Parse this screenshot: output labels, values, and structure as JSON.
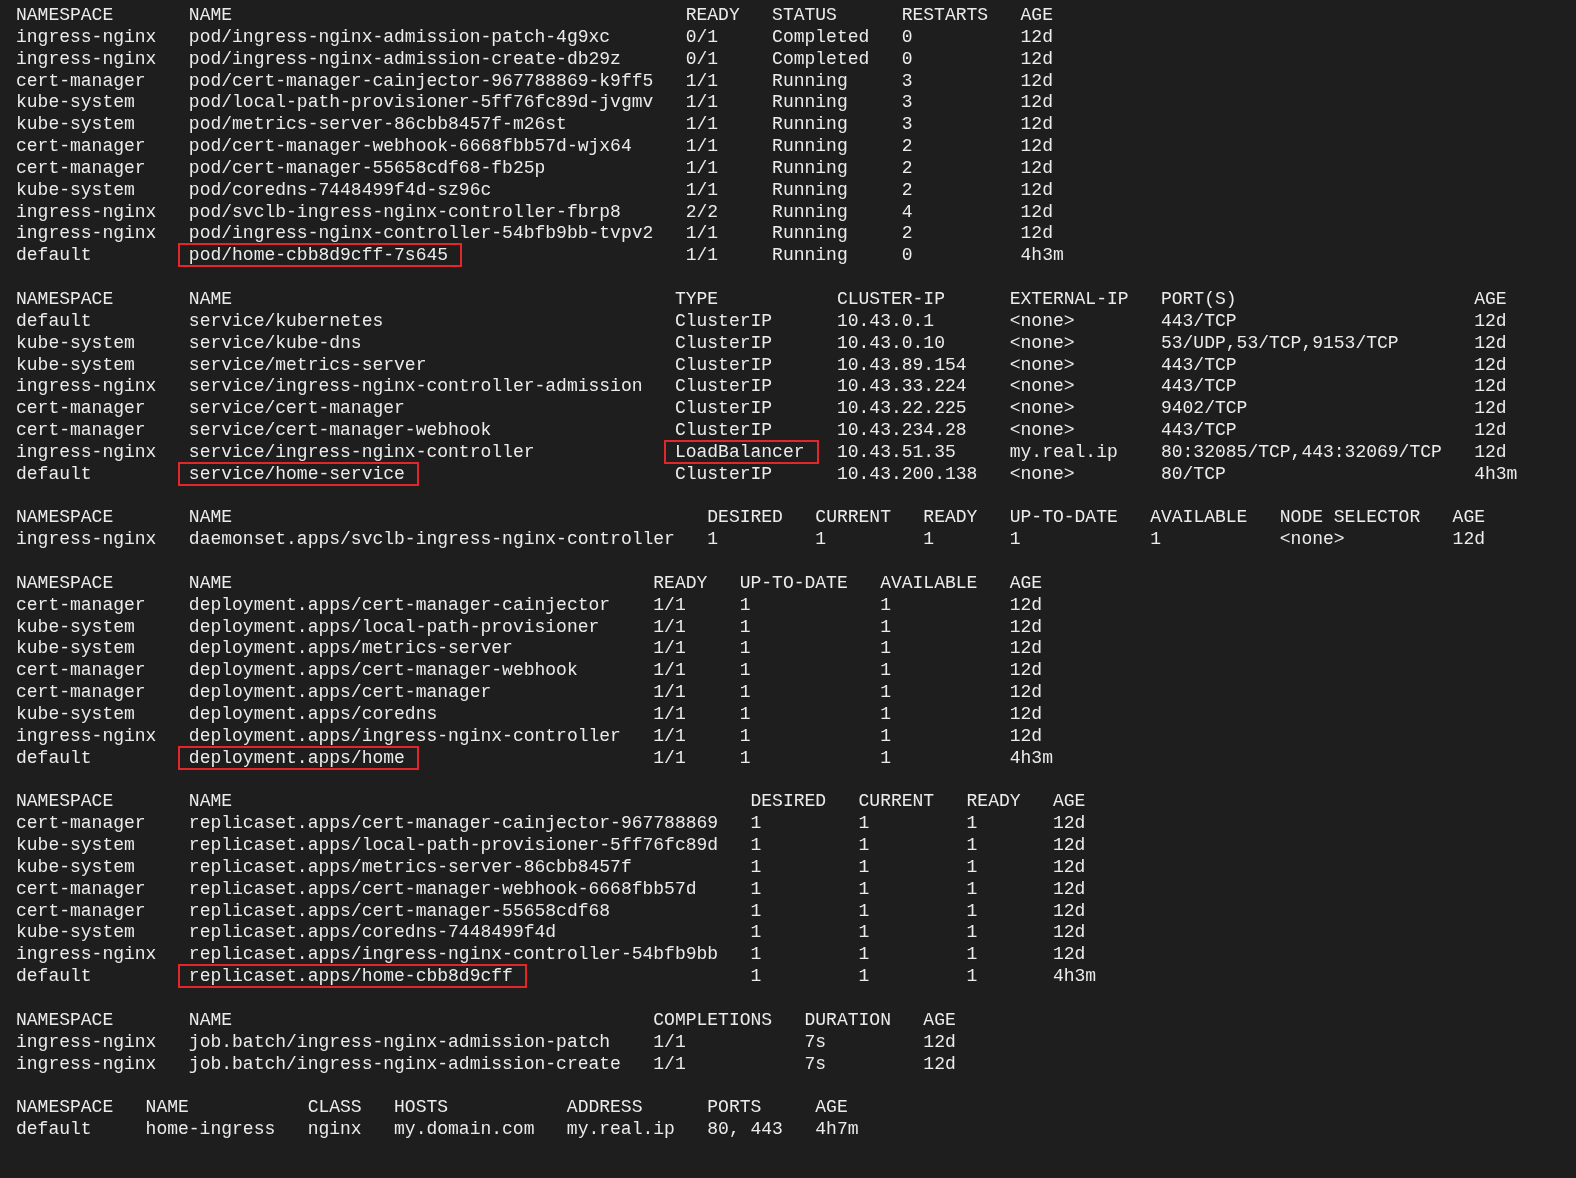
{
  "tables": [
    {
      "columns": [
        "NAMESPACE",
        "NAME",
        "READY",
        "STATUS",
        "RESTARTS",
        "AGE"
      ],
      "rows": [
        {
          "cells": [
            {
              "text": "ingress-nginx",
              "boxed": false
            },
            {
              "text": "pod/ingress-nginx-admission-patch-4g9xc",
              "boxed": false
            },
            {
              "text": "0/1",
              "boxed": false
            },
            {
              "text": "Completed",
              "boxed": false
            },
            {
              "text": "0",
              "boxed": false
            },
            {
              "text": "12d",
              "boxed": false
            }
          ]
        },
        {
          "cells": [
            {
              "text": "ingress-nginx",
              "boxed": false
            },
            {
              "text": "pod/ingress-nginx-admission-create-db29z",
              "boxed": false
            },
            {
              "text": "0/1",
              "boxed": false
            },
            {
              "text": "Completed",
              "boxed": false
            },
            {
              "text": "0",
              "boxed": false
            },
            {
              "text": "12d",
              "boxed": false
            }
          ]
        },
        {
          "cells": [
            {
              "text": "cert-manager",
              "boxed": false
            },
            {
              "text": "pod/cert-manager-cainjector-967788869-k9ff5",
              "boxed": false
            },
            {
              "text": "1/1",
              "boxed": false
            },
            {
              "text": "Running",
              "boxed": false
            },
            {
              "text": "3",
              "boxed": false
            },
            {
              "text": "12d",
              "boxed": false
            }
          ]
        },
        {
          "cells": [
            {
              "text": "kube-system",
              "boxed": false
            },
            {
              "text": "pod/local-path-provisioner-5ff76fc89d-jvgmv",
              "boxed": false
            },
            {
              "text": "1/1",
              "boxed": false
            },
            {
              "text": "Running",
              "boxed": false
            },
            {
              "text": "3",
              "boxed": false
            },
            {
              "text": "12d",
              "boxed": false
            }
          ]
        },
        {
          "cells": [
            {
              "text": "kube-system",
              "boxed": false
            },
            {
              "text": "pod/metrics-server-86cbb8457f-m26st",
              "boxed": false
            },
            {
              "text": "1/1",
              "boxed": false
            },
            {
              "text": "Running",
              "boxed": false
            },
            {
              "text": "3",
              "boxed": false
            },
            {
              "text": "12d",
              "boxed": false
            }
          ]
        },
        {
          "cells": [
            {
              "text": "cert-manager",
              "boxed": false
            },
            {
              "text": "pod/cert-manager-webhook-6668fbb57d-wjx64",
              "boxed": false
            },
            {
              "text": "1/1",
              "boxed": false
            },
            {
              "text": "Running",
              "boxed": false
            },
            {
              "text": "2",
              "boxed": false
            },
            {
              "text": "12d",
              "boxed": false
            }
          ]
        },
        {
          "cells": [
            {
              "text": "cert-manager",
              "boxed": false
            },
            {
              "text": "pod/cert-manager-55658cdf68-fb25p",
              "boxed": false
            },
            {
              "text": "1/1",
              "boxed": false
            },
            {
              "text": "Running",
              "boxed": false
            },
            {
              "text": "2",
              "boxed": false
            },
            {
              "text": "12d",
              "boxed": false
            }
          ]
        },
        {
          "cells": [
            {
              "text": "kube-system",
              "boxed": false
            },
            {
              "text": "pod/coredns-7448499f4d-sz96c",
              "boxed": false
            },
            {
              "text": "1/1",
              "boxed": false
            },
            {
              "text": "Running",
              "boxed": false
            },
            {
              "text": "2",
              "boxed": false
            },
            {
              "text": "12d",
              "boxed": false
            }
          ]
        },
        {
          "cells": [
            {
              "text": "ingress-nginx",
              "boxed": false
            },
            {
              "text": "pod/svclb-ingress-nginx-controller-fbrp8",
              "boxed": false
            },
            {
              "text": "2/2",
              "boxed": false
            },
            {
              "text": "Running",
              "boxed": false
            },
            {
              "text": "4",
              "boxed": false
            },
            {
              "text": "12d",
              "boxed": false
            }
          ]
        },
        {
          "cells": [
            {
              "text": "ingress-nginx",
              "boxed": false
            },
            {
              "text": "pod/ingress-nginx-controller-54bfb9bb-tvpv2",
              "boxed": false
            },
            {
              "text": "1/1",
              "boxed": false
            },
            {
              "text": "Running",
              "boxed": false
            },
            {
              "text": "2",
              "boxed": false
            },
            {
              "text": "12d",
              "boxed": false
            }
          ]
        },
        {
          "cells": [
            {
              "text": "default",
              "boxed": false
            },
            {
              "text": "pod/home-cbb8d9cff-7s645",
              "boxed": true
            },
            {
              "text": "1/1",
              "boxed": false
            },
            {
              "text": "Running",
              "boxed": false
            },
            {
              "text": "0",
              "boxed": false
            },
            {
              "text": "4h3m",
              "boxed": false
            }
          ]
        }
      ]
    },
    {
      "columns": [
        "NAMESPACE",
        "NAME",
        "TYPE",
        "CLUSTER-IP",
        "EXTERNAL-IP",
        "PORT(S)",
        "AGE"
      ],
      "rows": [
        {
          "cells": [
            {
              "text": "default",
              "boxed": false
            },
            {
              "text": "service/kubernetes",
              "boxed": false
            },
            {
              "text": "ClusterIP",
              "boxed": false
            },
            {
              "text": "10.43.0.1",
              "boxed": false
            },
            {
              "text": "<none>",
              "boxed": false
            },
            {
              "text": "443/TCP",
              "boxed": false
            },
            {
              "text": "12d",
              "boxed": false
            }
          ]
        },
        {
          "cells": [
            {
              "text": "kube-system",
              "boxed": false
            },
            {
              "text": "service/kube-dns",
              "boxed": false
            },
            {
              "text": "ClusterIP",
              "boxed": false
            },
            {
              "text": "10.43.0.10",
              "boxed": false
            },
            {
              "text": "<none>",
              "boxed": false
            },
            {
              "text": "53/UDP,53/TCP,9153/TCP",
              "boxed": false
            },
            {
              "text": "12d",
              "boxed": false
            }
          ]
        },
        {
          "cells": [
            {
              "text": "kube-system",
              "boxed": false
            },
            {
              "text": "service/metrics-server",
              "boxed": false
            },
            {
              "text": "ClusterIP",
              "boxed": false
            },
            {
              "text": "10.43.89.154",
              "boxed": false
            },
            {
              "text": "<none>",
              "boxed": false
            },
            {
              "text": "443/TCP",
              "boxed": false
            },
            {
              "text": "12d",
              "boxed": false
            }
          ]
        },
        {
          "cells": [
            {
              "text": "ingress-nginx",
              "boxed": false
            },
            {
              "text": "service/ingress-nginx-controller-admission",
              "boxed": false
            },
            {
              "text": "ClusterIP",
              "boxed": false
            },
            {
              "text": "10.43.33.224",
              "boxed": false
            },
            {
              "text": "<none>",
              "boxed": false
            },
            {
              "text": "443/TCP",
              "boxed": false
            },
            {
              "text": "12d",
              "boxed": false
            }
          ]
        },
        {
          "cells": [
            {
              "text": "cert-manager",
              "boxed": false
            },
            {
              "text": "service/cert-manager",
              "boxed": false
            },
            {
              "text": "ClusterIP",
              "boxed": false
            },
            {
              "text": "10.43.22.225",
              "boxed": false
            },
            {
              "text": "<none>",
              "boxed": false
            },
            {
              "text": "9402/TCP",
              "boxed": false
            },
            {
              "text": "12d",
              "boxed": false
            }
          ]
        },
        {
          "cells": [
            {
              "text": "cert-manager",
              "boxed": false
            },
            {
              "text": "service/cert-manager-webhook",
              "boxed": false
            },
            {
              "text": "ClusterIP",
              "boxed": false
            },
            {
              "text": "10.43.234.28",
              "boxed": false
            },
            {
              "text": "<none>",
              "boxed": false
            },
            {
              "text": "443/TCP",
              "boxed": false
            },
            {
              "text": "12d",
              "boxed": false
            }
          ]
        },
        {
          "cells": [
            {
              "text": "ingress-nginx",
              "boxed": false
            },
            {
              "text": "service/ingress-nginx-controller",
              "boxed": false
            },
            {
              "text": "LoadBalancer",
              "boxed": true
            },
            {
              "text": "10.43.51.35",
              "boxed": false
            },
            {
              "text": "my.real.ip",
              "boxed": false
            },
            {
              "text": "80:32085/TCP,443:32069/TCP",
              "boxed": false
            },
            {
              "text": "12d",
              "boxed": false
            }
          ]
        },
        {
          "cells": [
            {
              "text": "default",
              "boxed": false
            },
            {
              "text": "service/home-service",
              "boxed": true
            },
            {
              "text": "ClusterIP",
              "boxed": false
            },
            {
              "text": "10.43.200.138",
              "boxed": false
            },
            {
              "text": "<none>",
              "boxed": false
            },
            {
              "text": "80/TCP",
              "boxed": false
            },
            {
              "text": "4h3m",
              "boxed": false
            }
          ]
        }
      ]
    },
    {
      "columns": [
        "NAMESPACE",
        "NAME",
        "DESIRED",
        "CURRENT",
        "READY",
        "UP-TO-DATE",
        "AVAILABLE",
        "NODE SELECTOR",
        "AGE"
      ],
      "rows": [
        {
          "cells": [
            {
              "text": "ingress-nginx",
              "boxed": false
            },
            {
              "text": "daemonset.apps/svclb-ingress-nginx-controller",
              "boxed": false
            },
            {
              "text": "1",
              "boxed": false
            },
            {
              "text": "1",
              "boxed": false
            },
            {
              "text": "1",
              "boxed": false
            },
            {
              "text": "1",
              "boxed": false
            },
            {
              "text": "1",
              "boxed": false
            },
            {
              "text": "<none>",
              "boxed": false
            },
            {
              "text": "12d",
              "boxed": false
            }
          ]
        }
      ]
    },
    {
      "columns": [
        "NAMESPACE",
        "NAME",
        "READY",
        "UP-TO-DATE",
        "AVAILABLE",
        "AGE"
      ],
      "rows": [
        {
          "cells": [
            {
              "text": "cert-manager",
              "boxed": false
            },
            {
              "text": "deployment.apps/cert-manager-cainjector",
              "boxed": false
            },
            {
              "text": "1/1",
              "boxed": false
            },
            {
              "text": "1",
              "boxed": false
            },
            {
              "text": "1",
              "boxed": false
            },
            {
              "text": "12d",
              "boxed": false
            }
          ]
        },
        {
          "cells": [
            {
              "text": "kube-system",
              "boxed": false
            },
            {
              "text": "deployment.apps/local-path-provisioner",
              "boxed": false
            },
            {
              "text": "1/1",
              "boxed": false
            },
            {
              "text": "1",
              "boxed": false
            },
            {
              "text": "1",
              "boxed": false
            },
            {
              "text": "12d",
              "boxed": false
            }
          ]
        },
        {
          "cells": [
            {
              "text": "kube-system",
              "boxed": false
            },
            {
              "text": "deployment.apps/metrics-server",
              "boxed": false
            },
            {
              "text": "1/1",
              "boxed": false
            },
            {
              "text": "1",
              "boxed": false
            },
            {
              "text": "1",
              "boxed": false
            },
            {
              "text": "12d",
              "boxed": false
            }
          ]
        },
        {
          "cells": [
            {
              "text": "cert-manager",
              "boxed": false
            },
            {
              "text": "deployment.apps/cert-manager-webhook",
              "boxed": false
            },
            {
              "text": "1/1",
              "boxed": false
            },
            {
              "text": "1",
              "boxed": false
            },
            {
              "text": "1",
              "boxed": false
            },
            {
              "text": "12d",
              "boxed": false
            }
          ]
        },
        {
          "cells": [
            {
              "text": "cert-manager",
              "boxed": false
            },
            {
              "text": "deployment.apps/cert-manager",
              "boxed": false
            },
            {
              "text": "1/1",
              "boxed": false
            },
            {
              "text": "1",
              "boxed": false
            },
            {
              "text": "1",
              "boxed": false
            },
            {
              "text": "12d",
              "boxed": false
            }
          ]
        },
        {
          "cells": [
            {
              "text": "kube-system",
              "boxed": false
            },
            {
              "text": "deployment.apps/coredns",
              "boxed": false
            },
            {
              "text": "1/1",
              "boxed": false
            },
            {
              "text": "1",
              "boxed": false
            },
            {
              "text": "1",
              "boxed": false
            },
            {
              "text": "12d",
              "boxed": false
            }
          ]
        },
        {
          "cells": [
            {
              "text": "ingress-nginx",
              "boxed": false
            },
            {
              "text": "deployment.apps/ingress-nginx-controller",
              "boxed": false
            },
            {
              "text": "1/1",
              "boxed": false
            },
            {
              "text": "1",
              "boxed": false
            },
            {
              "text": "1",
              "boxed": false
            },
            {
              "text": "12d",
              "boxed": false
            }
          ]
        },
        {
          "cells": [
            {
              "text": "default",
              "boxed": false
            },
            {
              "text": "deployment.apps/home",
              "boxed": true
            },
            {
              "text": "1/1",
              "boxed": false
            },
            {
              "text": "1",
              "boxed": false
            },
            {
              "text": "1",
              "boxed": false
            },
            {
              "text": "4h3m",
              "boxed": false
            }
          ]
        }
      ]
    },
    {
      "columns": [
        "NAMESPACE",
        "NAME",
        "DESIRED",
        "CURRENT",
        "READY",
        "AGE"
      ],
      "rows": [
        {
          "cells": [
            {
              "text": "cert-manager",
              "boxed": false
            },
            {
              "text": "replicaset.apps/cert-manager-cainjector-967788869",
              "boxed": false
            },
            {
              "text": "1",
              "boxed": false
            },
            {
              "text": "1",
              "boxed": false
            },
            {
              "text": "1",
              "boxed": false
            },
            {
              "text": "12d",
              "boxed": false
            }
          ]
        },
        {
          "cells": [
            {
              "text": "kube-system",
              "boxed": false
            },
            {
              "text": "replicaset.apps/local-path-provisioner-5ff76fc89d",
              "boxed": false
            },
            {
              "text": "1",
              "boxed": false
            },
            {
              "text": "1",
              "boxed": false
            },
            {
              "text": "1",
              "boxed": false
            },
            {
              "text": "12d",
              "boxed": false
            }
          ]
        },
        {
          "cells": [
            {
              "text": "kube-system",
              "boxed": false
            },
            {
              "text": "replicaset.apps/metrics-server-86cbb8457f",
              "boxed": false
            },
            {
              "text": "1",
              "boxed": false
            },
            {
              "text": "1",
              "boxed": false
            },
            {
              "text": "1",
              "boxed": false
            },
            {
              "text": "12d",
              "boxed": false
            }
          ]
        },
        {
          "cells": [
            {
              "text": "cert-manager",
              "boxed": false
            },
            {
              "text": "replicaset.apps/cert-manager-webhook-6668fbb57d",
              "boxed": false
            },
            {
              "text": "1",
              "boxed": false
            },
            {
              "text": "1",
              "boxed": false
            },
            {
              "text": "1",
              "boxed": false
            },
            {
              "text": "12d",
              "boxed": false
            }
          ]
        },
        {
          "cells": [
            {
              "text": "cert-manager",
              "boxed": false
            },
            {
              "text": "replicaset.apps/cert-manager-55658cdf68",
              "boxed": false
            },
            {
              "text": "1",
              "boxed": false
            },
            {
              "text": "1",
              "boxed": false
            },
            {
              "text": "1",
              "boxed": false
            },
            {
              "text": "12d",
              "boxed": false
            }
          ]
        },
        {
          "cells": [
            {
              "text": "kube-system",
              "boxed": false
            },
            {
              "text": "replicaset.apps/coredns-7448499f4d",
              "boxed": false
            },
            {
              "text": "1",
              "boxed": false
            },
            {
              "text": "1",
              "boxed": false
            },
            {
              "text": "1",
              "boxed": false
            },
            {
              "text": "12d",
              "boxed": false
            }
          ]
        },
        {
          "cells": [
            {
              "text": "ingress-nginx",
              "boxed": false
            },
            {
              "text": "replicaset.apps/ingress-nginx-controller-54bfb9bb",
              "boxed": false
            },
            {
              "text": "1",
              "boxed": false
            },
            {
              "text": "1",
              "boxed": false
            },
            {
              "text": "1",
              "boxed": false
            },
            {
              "text": "12d",
              "boxed": false
            }
          ]
        },
        {
          "cells": [
            {
              "text": "default",
              "boxed": false
            },
            {
              "text": "replicaset.apps/home-cbb8d9cff",
              "boxed": true
            },
            {
              "text": "1",
              "boxed": false
            },
            {
              "text": "1",
              "boxed": false
            },
            {
              "text": "1",
              "boxed": false
            },
            {
              "text": "4h3m",
              "boxed": false
            }
          ]
        }
      ]
    },
    {
      "columns": [
        "NAMESPACE",
        "NAME",
        "COMPLETIONS",
        "DURATION",
        "AGE"
      ],
      "rows": [
        {
          "cells": [
            {
              "text": "ingress-nginx",
              "boxed": false
            },
            {
              "text": "job.batch/ingress-nginx-admission-patch",
              "boxed": false
            },
            {
              "text": "1/1",
              "boxed": false
            },
            {
              "text": "7s",
              "boxed": false
            },
            {
              "text": "12d",
              "boxed": false
            }
          ]
        },
        {
          "cells": [
            {
              "text": "ingress-nginx",
              "boxed": false
            },
            {
              "text": "job.batch/ingress-nginx-admission-create",
              "boxed": false
            },
            {
              "text": "1/1",
              "boxed": false
            },
            {
              "text": "7s",
              "boxed": false
            },
            {
              "text": "12d",
              "boxed": false
            }
          ]
        }
      ]
    },
    {
      "columns": [
        "NAMESPACE",
        "NAME",
        "CLASS",
        "HOSTS",
        "ADDRESS",
        "PORTS",
        "AGE"
      ],
      "rows": [
        {
          "cells": [
            {
              "text": "default",
              "boxed": false
            },
            {
              "text": "home-ingress",
              "boxed": false
            },
            {
              "text": "nginx",
              "boxed": false
            },
            {
              "text": "my.domain.com",
              "boxed": false
            },
            {
              "text": "my.real.ip",
              "boxed": false
            },
            {
              "text": "80, 443",
              "boxed": false
            },
            {
              "text": "4h7m",
              "boxed": false
            }
          ]
        }
      ]
    }
  ]
}
